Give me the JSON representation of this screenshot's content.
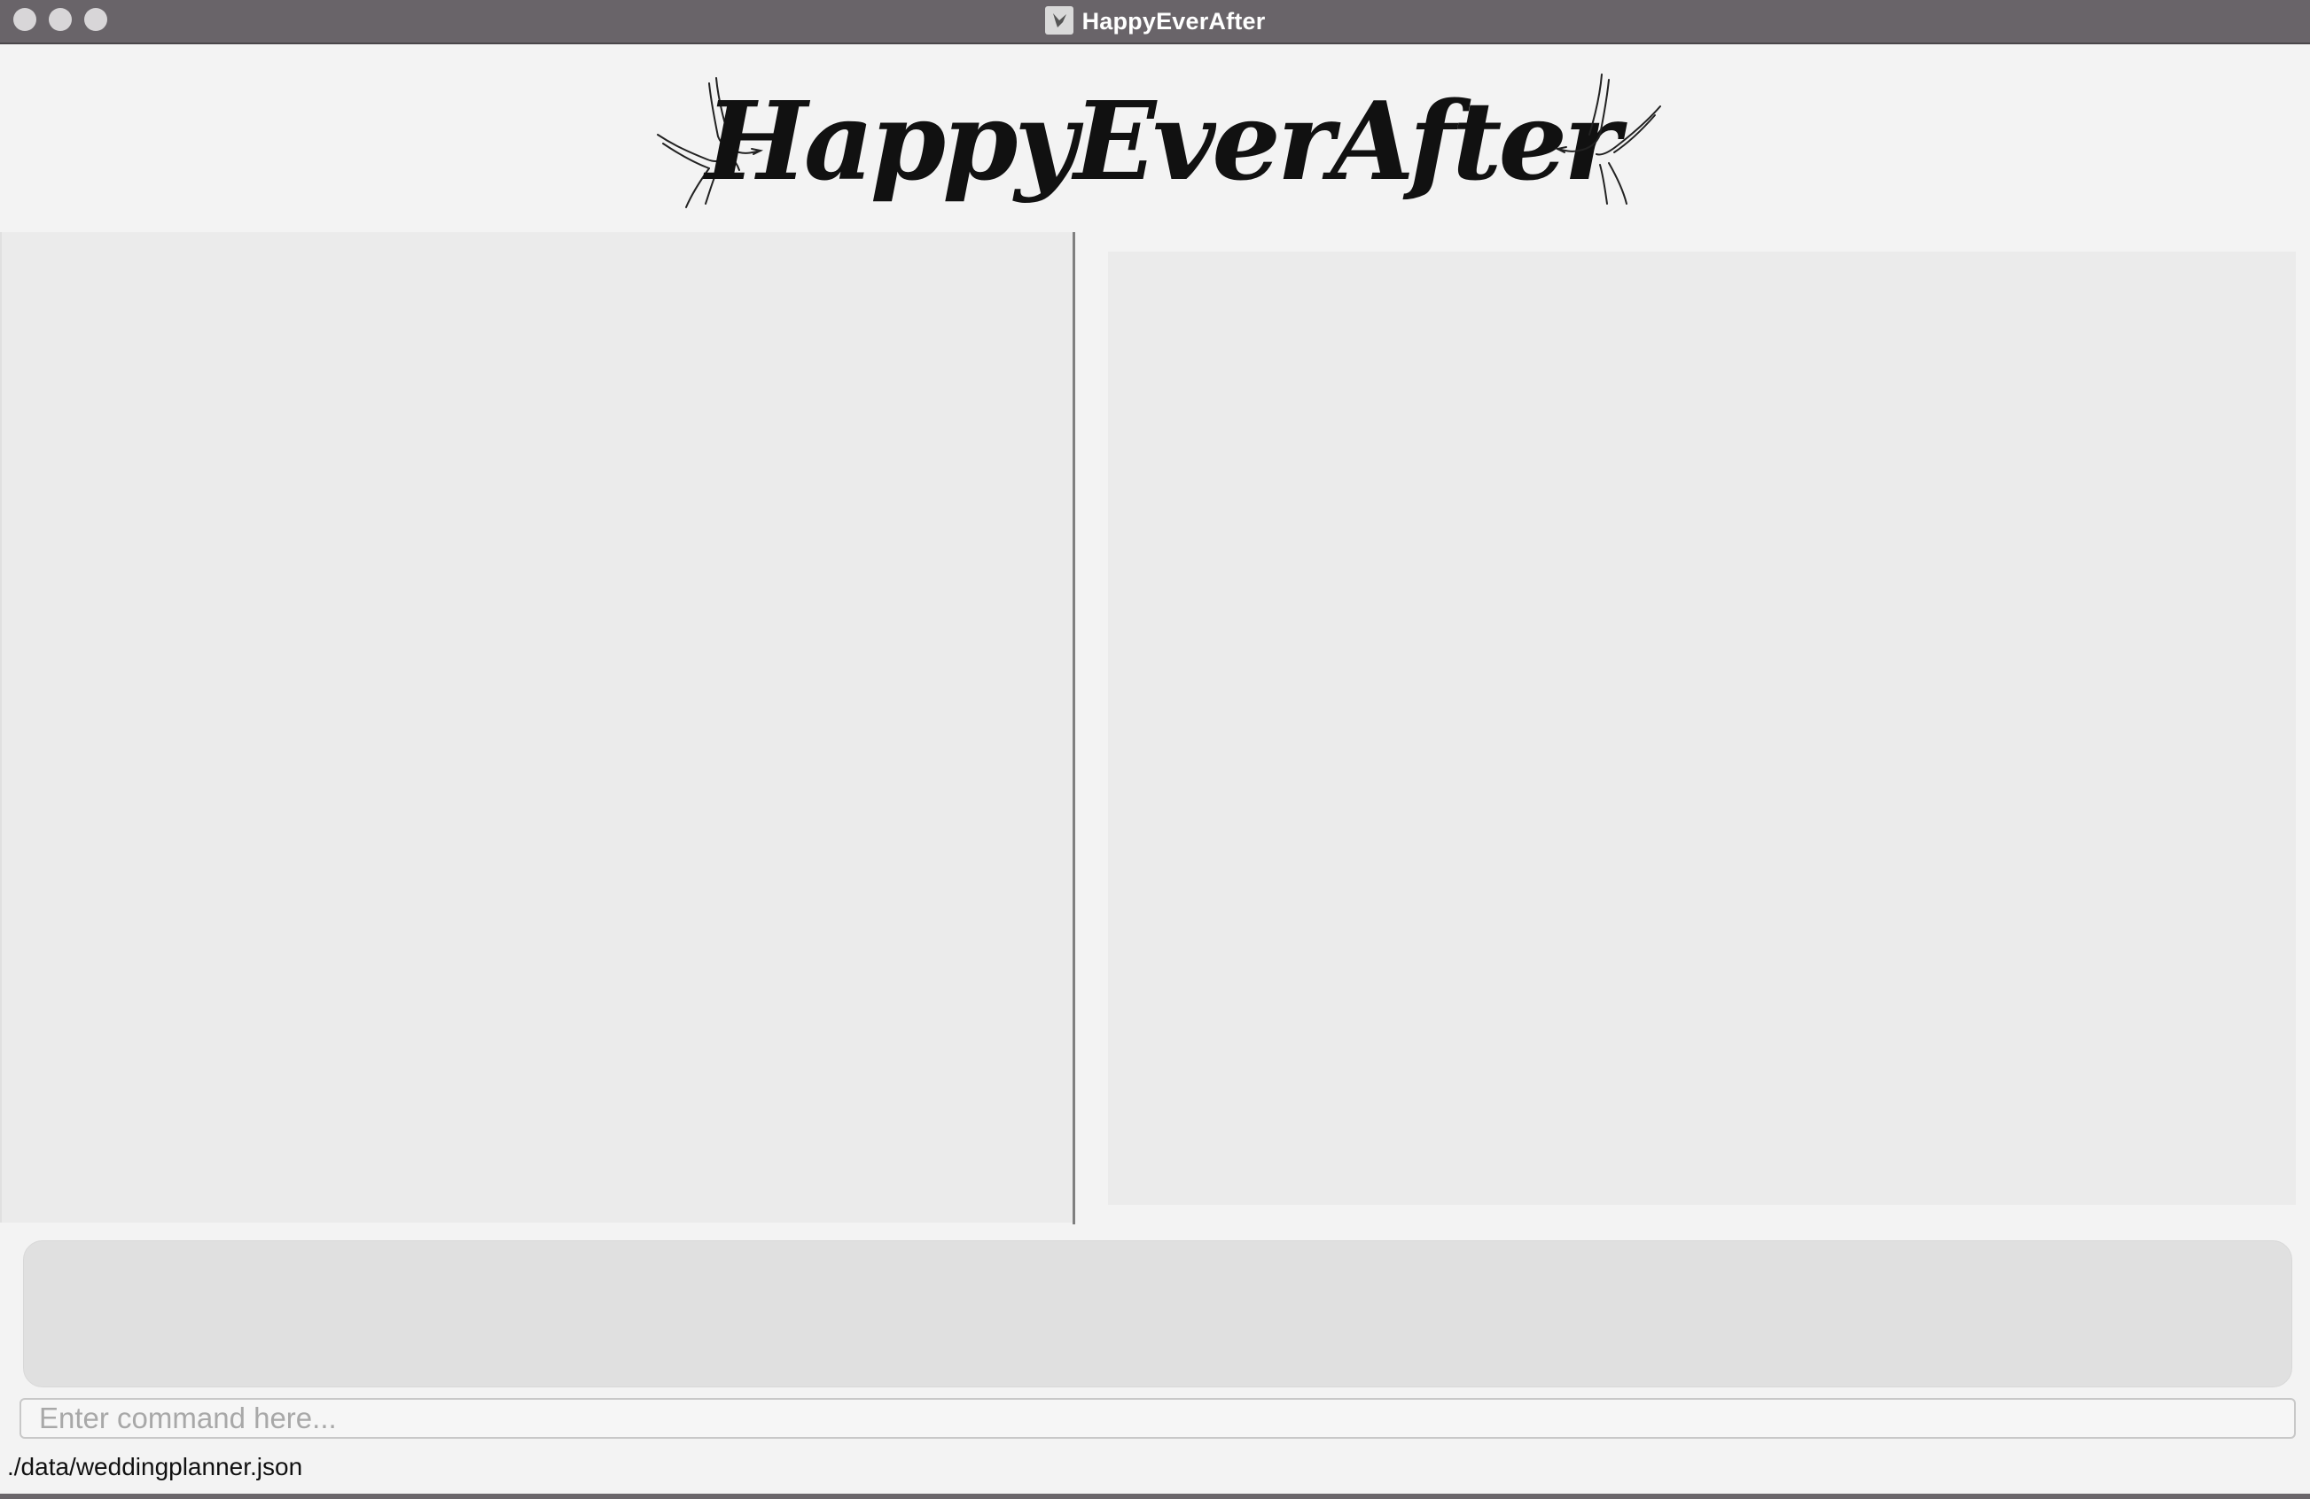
{
  "window": {
    "title": "HappyEverAfter"
  },
  "banner": {
    "logo_text": "HappyEverAfter",
    "icons": [
      "dove-icon",
      "dove-icon"
    ]
  },
  "command": {
    "placeholder": "Enter command here...",
    "value": ""
  },
  "status": {
    "file_path": "./data/weddingplanner.json"
  },
  "colors": {
    "titlebar": "#696469",
    "background": "#f3f3f3",
    "panel": "#ebebeb",
    "result": "#e0e0e0"
  }
}
